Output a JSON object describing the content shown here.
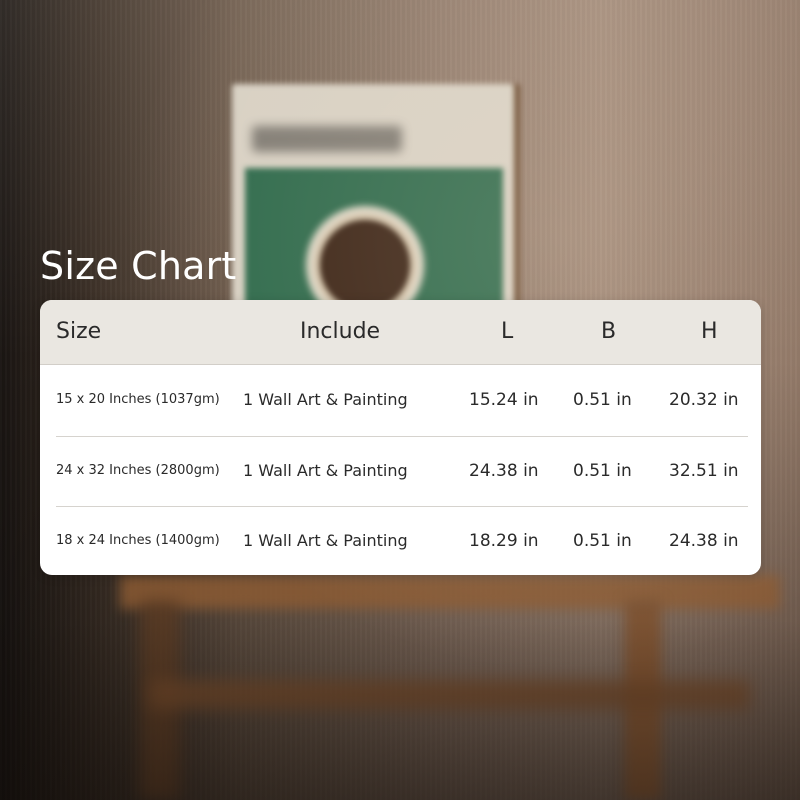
{
  "title": "Size Chart",
  "table": {
    "headers": {
      "size": "Size",
      "include": "Include",
      "l": "L",
      "b": "B",
      "h": "H"
    },
    "rows": [
      {
        "size": "15 x 20 Inches (1037gm)",
        "include": "1 Wall Art & Painting",
        "l": "15.24 in",
        "b": "0.51 in",
        "h": "20.32 in"
      },
      {
        "size": "24 x 32 Inches (2800gm)",
        "include": "1 Wall Art & Painting",
        "l": "24.38 in",
        "b": "0.51 in",
        "h": "32.51 in"
      },
      {
        "size": "18 x 24 Inches (1400gm)",
        "include": "1 Wall Art & Painting",
        "l": "18.29 in",
        "b": "0.51 in",
        "h": "24.38 in"
      }
    ]
  },
  "colors": {
    "header_bg": "#eae7e1",
    "card_bg": "#ffffff",
    "title_text": "#ffffff",
    "text": "#2a2a2a"
  }
}
